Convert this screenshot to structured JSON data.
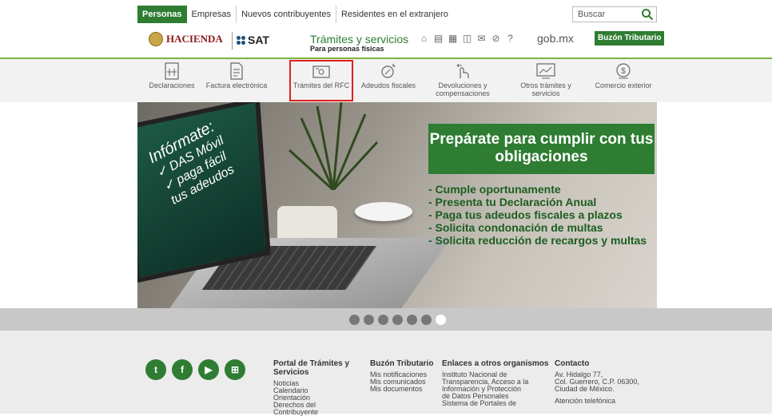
{
  "topbar": {
    "tabs": [
      "Personas",
      "Empresas",
      "Nuevos contribuyentes",
      "Residentes en el extranjero"
    ],
    "search_placeholder": "Buscar"
  },
  "header": {
    "logo_hacienda": "HACIENDA",
    "logo_sat": "SAT",
    "title": "Trámites y servicios",
    "subtitle": "Para personas físicas",
    "gobmx": "gob.mx",
    "buzon": "Buzón Tributario"
  },
  "nav": {
    "items": [
      {
        "label": "Declaraciones",
        "icon": "declaraciones-icon"
      },
      {
        "label": "Factura electrónica",
        "icon": "factura-icon"
      },
      {
        "label": "Trámites del RFC",
        "icon": "rfc-icon"
      },
      {
        "label": "Adeudos fiscales",
        "icon": "adeudos-icon"
      },
      {
        "label": "Devoluciones y compensaciones",
        "icon": "devoluciones-icon"
      },
      {
        "label": "Otros trámites y servicios",
        "icon": "otros-icon"
      },
      {
        "label": "Comercio exterior",
        "icon": "comercio-icon"
      }
    ],
    "selected_index": 2
  },
  "hero": {
    "screen_title": "Infórmate:",
    "screen_lines": [
      "✓ DAS Móvil",
      "✓ paga fácil",
      "tus adeudos"
    ],
    "box_title": "Prepárate para cumplir con tus obligaciones",
    "list": [
      "- Cumple oportunamente",
      "- Presenta tu Declaración Anual",
      "- Paga tus adeudos fiscales a plazos",
      "- Solicita condonación de multas",
      "- Solicita reducción de recargos y multas"
    ]
  },
  "carousel": {
    "count": 7,
    "active": 7
  },
  "footer": {
    "social": [
      "Twitter",
      "Facebook",
      "YouTube",
      "Sitemap"
    ],
    "portal": {
      "title": "Portal de Trámites y Servicios",
      "links": [
        "Noticias",
        "Calendario",
        "Orientación",
        "Derechos del Contribuyente"
      ]
    },
    "buzon": {
      "title": "Buzón Tributario",
      "links": [
        "Mis notificaciones",
        "Mis comunicados",
        "Mis documentos"
      ]
    },
    "enlaces": {
      "title": "Enlaces a otros organismos",
      "links": [
        "Instituto Nacional de",
        "Transparencia, Acceso a la",
        "Información y Protección",
        "de Datos Personales",
        "Sistema de Portales de"
      ]
    },
    "contacto": {
      "title": "Contacto",
      "lines": [
        "Av. Hidalgo 77,",
        "Col. Guerrero, C.P. 06300,",
        "Ciudad de México.",
        "",
        "Atención telefónica"
      ]
    }
  },
  "colors": {
    "green": "#2e7d32",
    "highlight": "#e0201c"
  }
}
